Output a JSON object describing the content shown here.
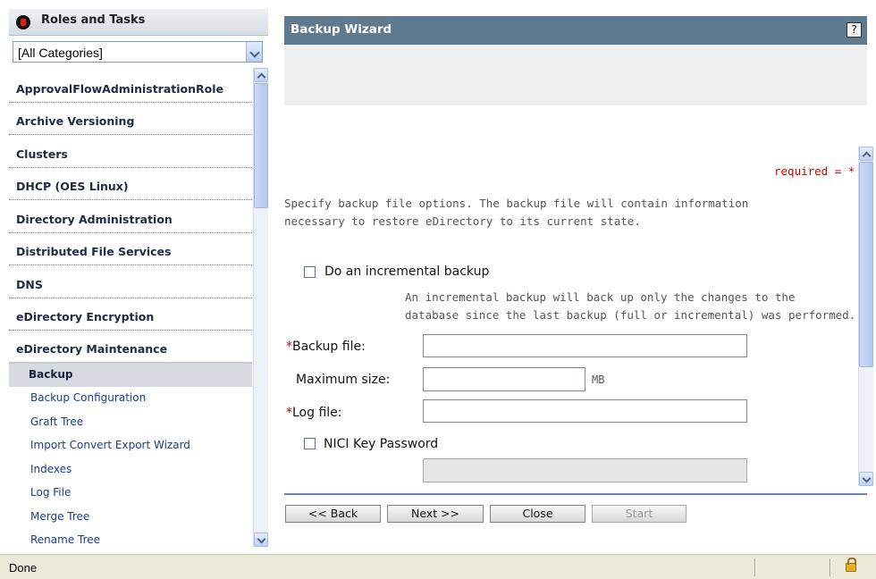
{
  "left": {
    "header_title": "Roles and Tasks",
    "category_value": "[All Categories]",
    "categories": [
      "ApprovalFlowAdministrationRole",
      "Archive Versioning",
      "Clusters",
      "DHCP (OES Linux)",
      "Directory Administration",
      "Distributed File Services",
      "DNS",
      "eDirectory Encryption",
      "eDirectory Maintenance"
    ],
    "tasks": [
      "Backup",
      "Backup Configuration",
      "Graft Tree",
      "Import Convert Export Wizard",
      "Indexes",
      "Log File",
      "Merge Tree",
      "Rename Tree"
    ],
    "selected_task_index": 0
  },
  "wizard": {
    "title": "Backup Wizard",
    "help_icon": "?",
    "required_note": "required = *",
    "intro_line1": "Specify backup file options. The backup file will contain information",
    "intro_line2": "necessary to restore eDirectory to its current state.",
    "incremental_label": "Do an incremental backup",
    "incremental_help_line1": "An incremental backup will back up only the changes to the",
    "incremental_help_line2": "database since the last backup (full or incremental) was performed.",
    "required_mark": "*",
    "backup_file_label": "Backup file:",
    "backup_file_value": "",
    "max_size_label": "Maximum size:",
    "max_size_value": "",
    "max_size_unit": "MB",
    "log_file_label": "Log file:",
    "log_file_value": "",
    "nici_label": "NICI Key Password",
    "nici_value": "",
    "buttons": {
      "back": "<< Back",
      "next": "Next >>",
      "close": "Close",
      "start": "Start"
    }
  },
  "status": {
    "text": "Done"
  },
  "colors": {
    "header_bar": "#5f7a8f",
    "required": "#d10000",
    "task_link": "#1c3e84"
  }
}
